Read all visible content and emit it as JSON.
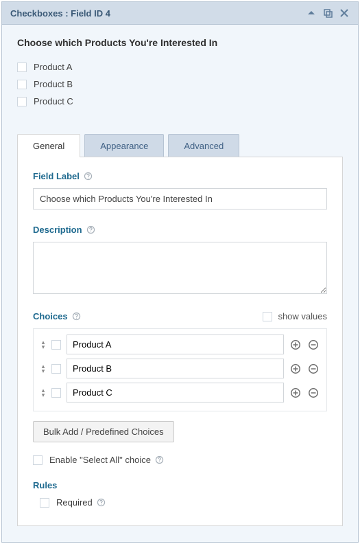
{
  "header": {
    "title": "Checkboxes : Field ID 4"
  },
  "preview": {
    "title": "Choose which Products You're Interested In",
    "options": [
      "Product A",
      "Product B",
      "Product C"
    ]
  },
  "tabs": {
    "general": "General",
    "appearance": "Appearance",
    "advanced": "Advanced"
  },
  "settings": {
    "fieldLabel": {
      "label": "Field Label",
      "value": "Choose which Products You're Interested In"
    },
    "description": {
      "label": "Description",
      "value": ""
    },
    "choices": {
      "label": "Choices",
      "showValuesLabel": "show values",
      "items": [
        "Product A",
        "Product B",
        "Product C"
      ],
      "bulkButton": "Bulk Add / Predefined Choices",
      "selectAllLabel": "Enable \"Select All\" choice"
    },
    "rules": {
      "label": "Rules",
      "requiredLabel": "Required"
    }
  }
}
